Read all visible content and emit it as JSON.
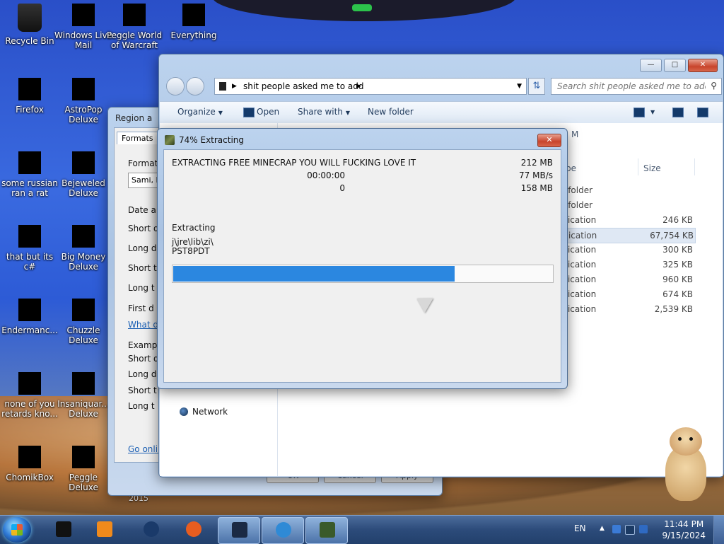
{
  "desktop": {
    "icons": [
      {
        "label": "Recycle Bin",
        "icon": "recycle-bin-icon"
      },
      {
        "label": "Windows Live Mail",
        "icon": "mail-icon"
      },
      {
        "label": "Peggle World of Warcraft",
        "icon": "peggle-icon"
      },
      {
        "label": "Everything",
        "icon": "everything-icon"
      },
      {
        "label": "Firefox",
        "icon": "firefox-icon"
      },
      {
        "label": "AstroPop Deluxe",
        "icon": "astropop-icon"
      },
      {
        "label": "some russian ran a rat",
        "icon": "app-icon"
      },
      {
        "label": "Bejeweled Deluxe",
        "icon": "bejeweled-icon"
      },
      {
        "label": "that but its c#",
        "icon": "app-icon"
      },
      {
        "label": "Big Money Deluxe",
        "icon": "bigmoney-icon"
      },
      {
        "label": "Endermanc...",
        "icon": "app-icon"
      },
      {
        "label": "Chuzzle Deluxe",
        "icon": "chuzzle-icon"
      },
      {
        "label": "none of you retards kno...",
        "icon": "app-icon"
      },
      {
        "label": "Insaniquar... Deluxe",
        "icon": "insaniquarium-icon"
      },
      {
        "label": "ChomikBox",
        "icon": "chomikbox-icon"
      },
      {
        "label": "Peggle Deluxe",
        "icon": "peggle-icon"
      }
    ],
    "year_text": "2015"
  },
  "region_window": {
    "title": "Region a",
    "tab": "Formats",
    "format_label": "Format:",
    "format_value": "Sami, In",
    "date_label": "Date a",
    "lines": [
      "Short d",
      "Long d",
      "Short t",
      "Long t",
      "First d"
    ],
    "what_link": "What d",
    "examples_label": "Examp",
    "example_lines": [
      "Short d",
      "Long d",
      "Short t",
      "Long t"
    ],
    "online_link": "Go onlin",
    "buttons": [
      "OK",
      "Cancel",
      "Apply"
    ]
  },
  "explorer": {
    "address_crumb": "shit people asked me to add",
    "search_placeholder": "Search shit people asked me to add",
    "toolbar": {
      "organize": "Organize",
      "open": "Open",
      "share_with": "Share with",
      "new_folder": "New folder"
    },
    "col_m": "M",
    "col_type": "pe",
    "col_size": "Size",
    "nav_network": "Network",
    "rows": [
      {
        "type": "e folder",
        "size": ""
      },
      {
        "type": "e folder",
        "size": ""
      },
      {
        "type": "plication",
        "size": "246 KB"
      },
      {
        "type": "plication",
        "size": "67,754 KB",
        "selected": true
      },
      {
        "type": "plication",
        "size": "300 KB"
      },
      {
        "type": "plication",
        "size": "325 KB"
      },
      {
        "type": "plication",
        "size": "960 KB"
      },
      {
        "type": "plication",
        "size": "674 KB"
      },
      {
        "type": "plication",
        "size": "2,539 KB"
      }
    ]
  },
  "extract_dialog": {
    "title": "74% Extracting",
    "archive_line": "EXTRACTING FREE MINECRAP YOU WILL FUCKING LOVE IT",
    "elapsed": "00:00:00",
    "errors": "0",
    "total_size": "212 MB",
    "speed": "77 MB/s",
    "processed": "158 MB",
    "status": "Extracting",
    "path": "j\\jre\\lib\\zi\\",
    "file": "PST8PDT",
    "progress": 0.74
  },
  "taskbar": {
    "apps": [
      "app-icon",
      "media-player-icon",
      "globe-icon",
      "firefox-icon",
      "window-icon",
      "network-globe-icon",
      "minecraft-icon"
    ],
    "language": "EN",
    "time": "11:44 PM",
    "date": "9/15/2024"
  },
  "colors": {
    "progress": "#2b87e0",
    "taskbar": "#2c4b7a"
  }
}
